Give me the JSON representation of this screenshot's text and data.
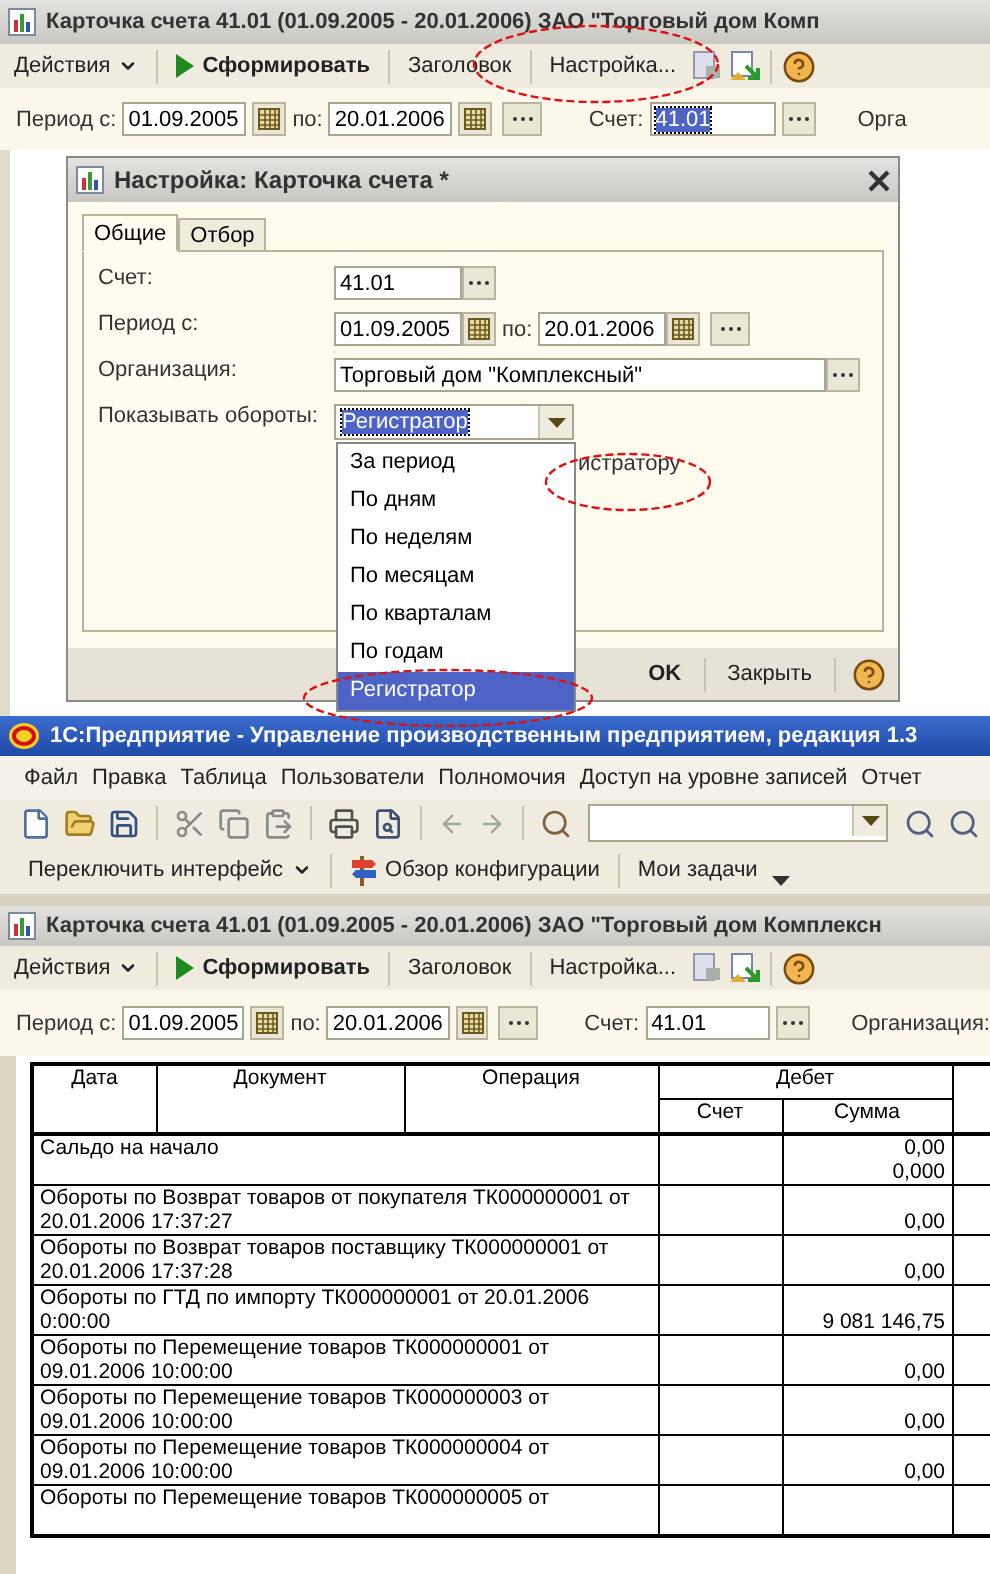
{
  "report_window": {
    "title": "Карточка счета 41.01 (01.09.2005 - 20.01.2006) ЗАО \"Торговый дом Комп",
    "toolbar": {
      "actions": "Действия",
      "generate": "Сформировать",
      "header": "Заголовок",
      "settings": "Настройка..."
    },
    "params": {
      "period_label": "Период с:",
      "period_from": "01.09.2005",
      "to_label": "по:",
      "period_to": "20.01.2006",
      "account_label": "Счет:",
      "account": "41.01",
      "account_selected": true,
      "organization_label": "Орга"
    }
  },
  "settings_dialog": {
    "title": "Настройка: Карточка счета *",
    "tabs": [
      {
        "label": "Общие",
        "selected": true
      },
      {
        "label": "Отбор",
        "selected": false
      }
    ],
    "account_label": "Счет:",
    "account": "41.01",
    "period_label": "Период с:",
    "period_from": "01.09.2005",
    "to_label": "по:",
    "period_to": "20.01.2006",
    "organization_label": "Организация:",
    "organization": "Торговый дом \"Комплексный\"",
    "turnover_label": "Показывать обороты:",
    "turnover": "Регистратор",
    "turnover_selected": true,
    "turnover_options": [
      {
        "label": "За период",
        "selected": false
      },
      {
        "label": "По дням",
        "selected": false
      },
      {
        "label": "По неделям",
        "selected": false
      },
      {
        "label": "По месяцам",
        "selected": false
      },
      {
        "label": "По кварталам",
        "selected": false
      },
      {
        "label": "По годам",
        "selected": false
      },
      {
        "label": "Регистратор",
        "selected": true
      }
    ],
    "hidden_text": "истратору",
    "ok": "OK",
    "close": "Закрыть"
  },
  "main_window": {
    "title": "1С:Предприятие - Управление производственным предприятием, редакция 1.3",
    "menu": [
      "Файл",
      "Правка",
      "Таблица",
      "Пользователи",
      "Полномочия",
      "Доступ на уровне записей",
      "Отчет"
    ],
    "panel": {
      "switch_interface": "Переключить интерфейс",
      "config_overview": "Обзор конфигурации",
      "my_tasks": "Мои задачи"
    }
  },
  "report": {
    "title": "Карточка счета 41.01 (01.09.2005 - 20.01.2006) ЗАО \"Торговый дом Комплексн",
    "toolbar": {
      "actions": "Действия",
      "generate": "Сформировать",
      "header": "Заголовок",
      "settings": "Настройка..."
    },
    "params": {
      "period_label": "Период с:",
      "period_from": "01.09.2005",
      "to_label": "по:",
      "period_to": "20.01.2006",
      "account_label": "Счет:",
      "account": "41.01",
      "account_selected": false,
      "organization_label": "Организация:"
    }
  },
  "table": {
    "columns": [
      "Дата",
      "Документ",
      "Операция"
    ],
    "group": "Дебет",
    "subcolumns": [
      "Счет",
      "Сумма"
    ],
    "rows": [
      {
        "text": "Сальдо на начало",
        "sums": [
          "0,00",
          "0,000"
        ]
      },
      {
        "text": "Обороты по Возврат товаров от покупателя ТК000000001 от 20.01.2006 17:37:27",
        "sums": [
          "0,00"
        ]
      },
      {
        "text": "Обороты по Возврат товаров поставщику ТК000000001 от 20.01.2006 17:37:28",
        "sums": [
          "0,00"
        ]
      },
      {
        "text": "Обороты по ГТД по импорту ТК000000001 от 20.01.2006 0:00:00",
        "sums": [
          "9 081 146,75"
        ]
      },
      {
        "text": "Обороты по Перемещение товаров ТК000000001 от 09.01.2006 10:00:00",
        "sums": [
          "0,00"
        ]
      },
      {
        "text": "Обороты по Перемещение товаров ТК000000003 от 09.01.2006 10:00:00",
        "sums": [
          "0,00"
        ]
      },
      {
        "text": "Обороты по Перемещение товаров ТК000000004 от 09.01.2006 10:00:00",
        "sums": [
          "0,00"
        ]
      },
      {
        "text": "Обороты по Перемещение товаров ТК000000005 от",
        "sums": []
      }
    ]
  }
}
